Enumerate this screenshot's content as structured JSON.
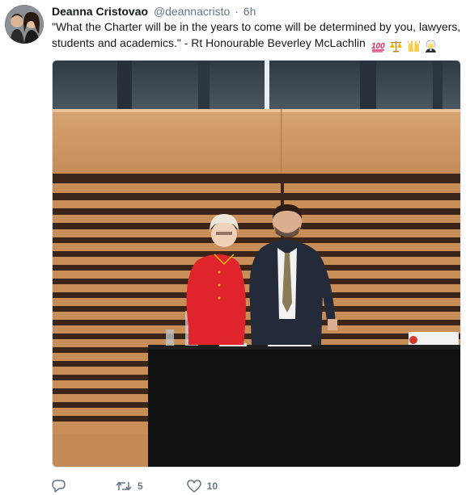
{
  "tweet": {
    "author": {
      "display_name": "Deanna Cristovao",
      "handle": "@deannacristo",
      "separator": "·",
      "timestamp": "6h"
    },
    "text": "\"What the Charter will be in the years to come will be determined by you, lawyers, students and academics.\" - Rt Honourable Beverley McLachlin",
    "emojis": [
      "hundred-points-emoji",
      "balance-scale-emoji",
      "raised-hands-emoji",
      "judge-emoji"
    ],
    "actions": {
      "reply_count": "",
      "retweet_count": "5",
      "like_count": "10"
    }
  },
  "colors": {
    "text": "#14171a",
    "secondary": "#657786",
    "emoji_red": "#e0245e"
  }
}
